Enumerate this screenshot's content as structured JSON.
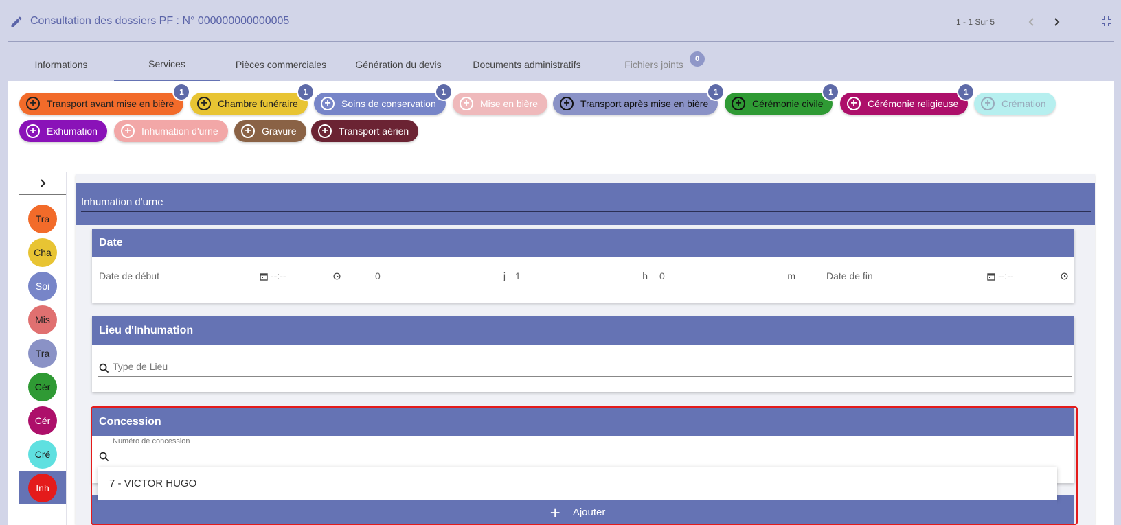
{
  "header": {
    "title": "Consultation des dossiers PF : N° 000000000000005",
    "pager": "1 - 1 Sur 5"
  },
  "tabs": [
    {
      "label": "Informations"
    },
    {
      "label": "Services"
    },
    {
      "label": "Pièces commerciales"
    },
    {
      "label": "Génération du devis"
    },
    {
      "label": "Documents administratifs"
    },
    {
      "label": "Fichiers joints",
      "badge": "0"
    }
  ],
  "chips": [
    {
      "label": "Transport avant mise en bière",
      "badge": "1",
      "color": "#f26b2a"
    },
    {
      "label": "Chambre funéraire",
      "badge": "1",
      "color": "#e8c433"
    },
    {
      "label": "Soins de conservation",
      "badge": "1",
      "color": "#7785c8"
    },
    {
      "label": "Mise en bière",
      "badge": "",
      "color": "#efb9bb"
    },
    {
      "label": "Transport après mise en bière",
      "badge": "1",
      "color": "#8a92c6"
    },
    {
      "label": "Cérémonie civile",
      "badge": "1",
      "color": "#2f9a34"
    },
    {
      "label": "Cérémonie religieuse",
      "badge": "1",
      "color": "#ad0f6a"
    },
    {
      "label": "Crémation",
      "badge": "",
      "color": "#b6efef"
    },
    {
      "label": "Exhumation",
      "badge": "",
      "color": "#8a12b8"
    },
    {
      "label": "Inhumation d'urne",
      "badge": "",
      "color": "#f2a7a7"
    },
    {
      "label": "Gravure",
      "badge": "",
      "color": "#8a6245"
    },
    {
      "label": "Transport aérien",
      "badge": "",
      "color": "#6b2333"
    }
  ],
  "sidebar": [
    {
      "label": "Tra",
      "color": "#f26b2a"
    },
    {
      "label": "Cha",
      "color": "#e8c433"
    },
    {
      "label": "Soi",
      "color": "#7785c8"
    },
    {
      "label": "Mis",
      "color": "#e07070"
    },
    {
      "label": "Tra",
      "color": "#8a92c6"
    },
    {
      "label": "Cér",
      "color": "#2f9a34"
    },
    {
      "label": "Cér",
      "color": "#ad0f6a"
    },
    {
      "label": "Cré",
      "color": "#5fe0e0"
    },
    {
      "label": "Inh",
      "color": "#e41b1b"
    }
  ],
  "panel": {
    "title": "Inhumation d'urne"
  },
  "date_section": {
    "title": "Date",
    "start_label": "Date de début",
    "time_placeholder": "--:--",
    "days_value": "0",
    "days_suffix": "j",
    "hours_value": "1",
    "hours_suffix": "h",
    "minutes_value": "0",
    "minutes_suffix": "m",
    "end_label": "Date de fin"
  },
  "lieu_section": {
    "title": "Lieu d'Inhumation",
    "placeholder": "Type de Lieu"
  },
  "concession_section": {
    "title": "Concession",
    "field_label": "Numéro de concession",
    "option": "7 - VICTOR HUGO",
    "add_label": "Ajouter"
  }
}
